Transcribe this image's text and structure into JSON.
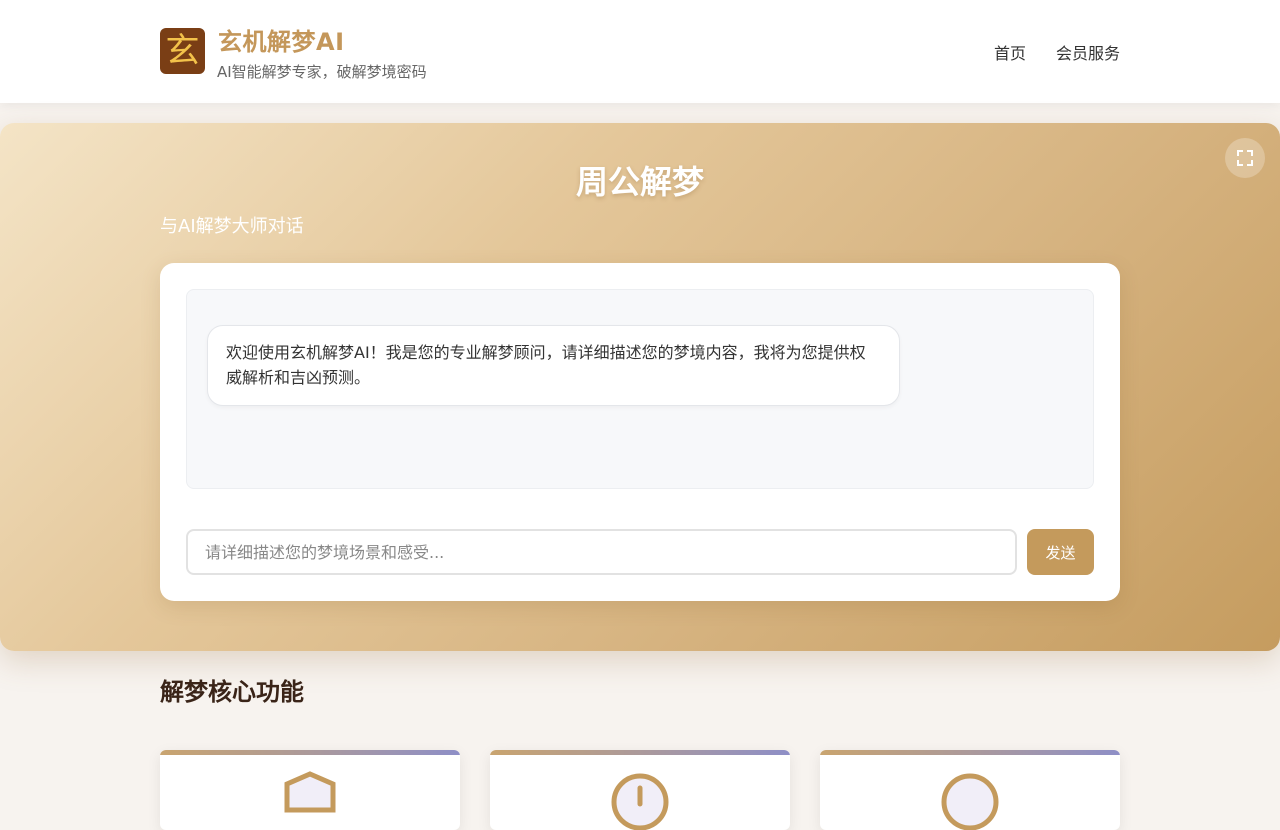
{
  "header": {
    "logo_glyph": "玄",
    "title": "玄机解梦AI",
    "tagline": "AI智能解梦专家，破解梦境密码",
    "nav": [
      {
        "label": "首页"
      },
      {
        "label": "会员服务"
      }
    ]
  },
  "hero": {
    "title": "周公解梦",
    "subtitle": "与AI解梦大师对话",
    "fullscreen_icon": "expand-icon"
  },
  "chat": {
    "messages": [
      {
        "role": "assistant",
        "text": "欢迎使用玄机解梦AI！我是您的专业解梦顾问，请详细描述您的梦境内容，我将为您提供权威解析和吉凶预测。"
      }
    ],
    "input": {
      "value": "",
      "placeholder": "请详细描述您的梦境场景和感受..."
    },
    "send_label": "发送"
  },
  "features": {
    "title": "解梦核心功能",
    "cards": [
      {
        "icon": "shield-icon"
      },
      {
        "icon": "clock-icon"
      },
      {
        "icon": "circle-icon"
      }
    ]
  },
  "colors": {
    "brand": "#c4975a",
    "logo_bg": "#7a3e15",
    "send_button": "#c49a5c",
    "hero_gradient_start": "#f4e4c6",
    "hero_gradient_end": "#c59c5f",
    "card_accent_start": "#c9a46f",
    "card_accent_end": "#8e8fc7"
  }
}
